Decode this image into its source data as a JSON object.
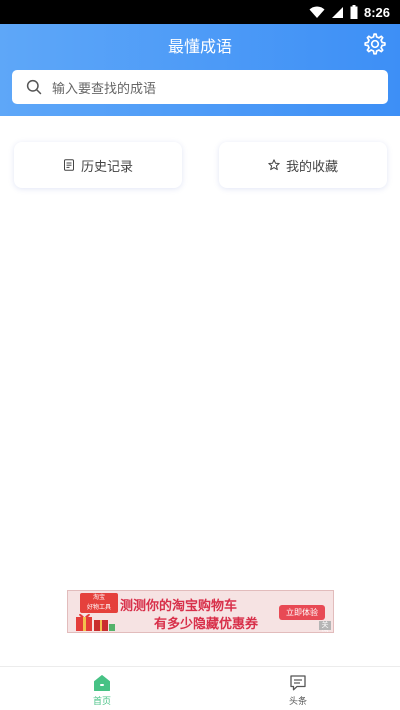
{
  "status_bar": {
    "time": "8:26",
    "icons": [
      "wifi-icon",
      "signal-icon",
      "battery-icon"
    ]
  },
  "header": {
    "title": "最懂成语",
    "settings_icon": "gear-icon"
  },
  "search": {
    "placeholder": "输入要查找的成语",
    "icon": "search-icon"
  },
  "quick_actions": [
    {
      "label": "历史记录",
      "icon": "document-icon"
    },
    {
      "label": "我的收藏",
      "icon": "star-icon"
    }
  ],
  "ad": {
    "badge_line1": "淘宝",
    "badge_line2": "好物工具",
    "line1": "测测你的淘宝购物车",
    "line2": "有多少隐藏优惠券",
    "cta": "立即体验",
    "close_label": "关闭"
  },
  "bottom_nav": {
    "items": [
      {
        "label": "首页",
        "icon": "home-icon",
        "active": true
      },
      {
        "label": "头条",
        "icon": "message-icon",
        "active": false
      }
    ]
  },
  "colors": {
    "header_start": "#5ea7f8",
    "header_end": "#3d8ff6",
    "active_tab": "#47c285",
    "ad_text": "#d8304a"
  }
}
